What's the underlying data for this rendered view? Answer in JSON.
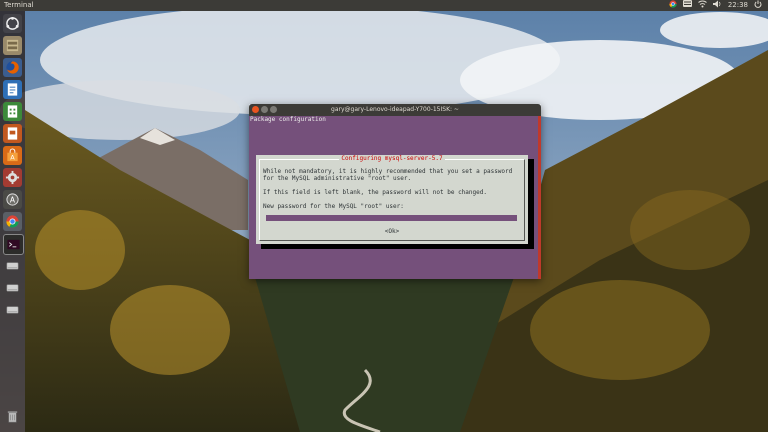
{
  "top_panel": {
    "app_title": "Terminal",
    "tray_icons": [
      "chrome-icon",
      "keyboard-icon",
      "network-icon",
      "volume-icon"
    ],
    "clock": "22:38",
    "session_icon": "power-icon"
  },
  "launcher": {
    "items": [
      {
        "name": "launcher-dash-button",
        "icon": "ubuntu-logo-icon"
      },
      {
        "name": "launcher-files-button",
        "icon": "file-cabinet-icon"
      },
      {
        "name": "launcher-firefox-button",
        "icon": "firefox-icon"
      },
      {
        "name": "launcher-writer-button",
        "icon": "writer-doc-icon"
      },
      {
        "name": "launcher-calc-button",
        "icon": "calc-sheet-icon"
      },
      {
        "name": "launcher-impress-button",
        "icon": "impress-slide-icon"
      },
      {
        "name": "launcher-software-center-button",
        "icon": "shopping-bag-icon"
      },
      {
        "name": "launcher-settings-button",
        "icon": "gear-icon"
      },
      {
        "name": "launcher-update-button",
        "icon": "update-icon"
      },
      {
        "name": "launcher-chrome-button",
        "icon": "chrome-icon"
      },
      {
        "name": "launcher-terminal-button",
        "icon": "terminal-icon"
      },
      {
        "name": "launcher-drive-1-button",
        "icon": "drive-icon"
      },
      {
        "name": "launcher-drive-2-button",
        "icon": "drive-icon"
      },
      {
        "name": "launcher-drive-3-button",
        "icon": "drive-icon"
      },
      {
        "name": "launcher-trash-button",
        "icon": "trash-icon"
      }
    ]
  },
  "terminal": {
    "title": "gary@gary-Lenovo-ideapad-Y700-15ISK: ~",
    "header_text": "Package configuration"
  },
  "dialog": {
    "title": "Configuring mysql-server-5.7",
    "line1": "While not mandatory, it is highly recommended that you set a password",
    "line2": "for the MySQL administrative \"root\" user.",
    "line3": "If this field is left blank, the password will not be changed.",
    "prompt": "New password for the MySQL \"root\" user:",
    "password_value": "",
    "ok_label": "<Ok>"
  },
  "colors": {
    "terminal_bg": "#75507b",
    "dialog_bg": "#d3d7cf",
    "dialog_title": "#cc0000",
    "panel": "#3c3b37"
  }
}
